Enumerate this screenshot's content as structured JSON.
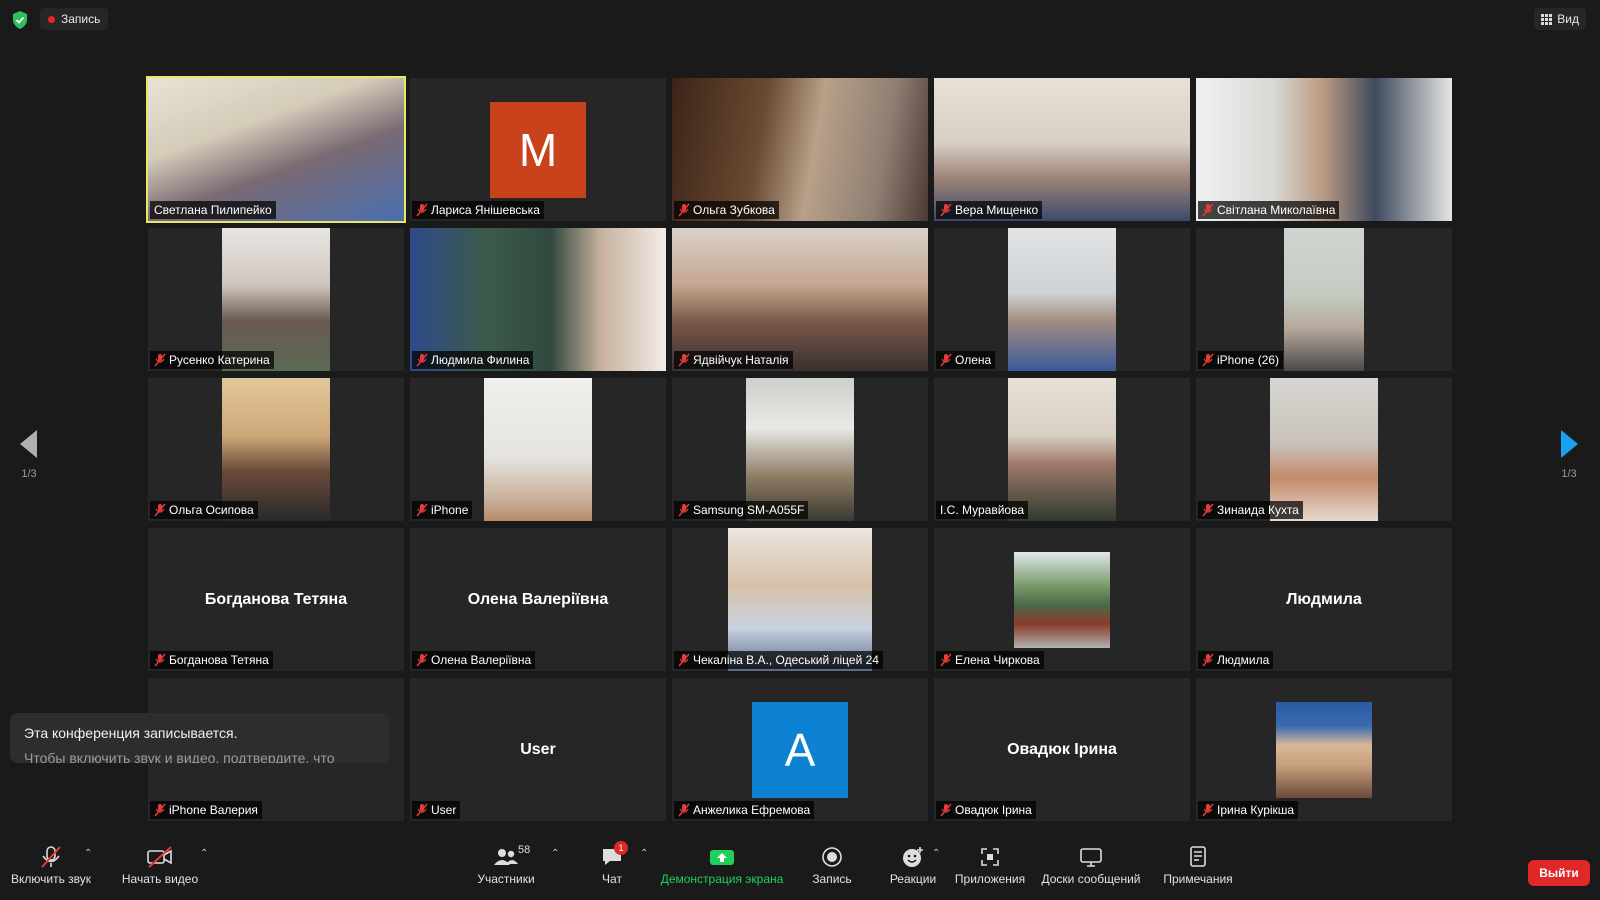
{
  "top": {
    "recording_label": "Запись",
    "view_label": "Вид"
  },
  "pager": {
    "left": "1/3",
    "right": "1/3"
  },
  "tiles": [
    {
      "name": "Светлана Пилипейко"
    },
    {
      "name": "Лариса Янішевська",
      "avatar": "M"
    },
    {
      "name": "Ольга Зубкова"
    },
    {
      "name": "Вера Мищенко"
    },
    {
      "name": "Світлана Миколаївна"
    },
    {
      "name": "Русенко Катерина"
    },
    {
      "name": "Людмила Филина"
    },
    {
      "name": "Ядвійчук Наталія"
    },
    {
      "name": "Олена"
    },
    {
      "name": "iPhone (26)"
    },
    {
      "name": "Ольга Осипова"
    },
    {
      "name": "iPhone"
    },
    {
      "name": "Samsung SM-A055F"
    },
    {
      "name": "І.С. Муравйова"
    },
    {
      "name": "Зинаида Кухта"
    },
    {
      "name": "Богданова Тетяна",
      "display": "Богданова Тетяна"
    },
    {
      "name": "Олена Валеріївна",
      "display": "Олена Валеріївна"
    },
    {
      "name": "Чекаліна В.А., Одеський ліцей 24"
    },
    {
      "name": "Елена Чиркова"
    },
    {
      "name": "Людмила",
      "display": "Людмила"
    },
    {
      "name": "iPhone Валерия"
    },
    {
      "name": "User",
      "display": "User"
    },
    {
      "name": "Анжелика Ефремова",
      "avatar": "A"
    },
    {
      "name": "Овадюк Ірина",
      "display": "Овадюк Ірина"
    },
    {
      "name": "Ірина Курікша"
    }
  ],
  "toast": {
    "line1": "Эта конференция записывается.",
    "line2": "Чтобы включить звук и видео, подтвердите, что"
  },
  "toolbar": {
    "mute": "Включить звук",
    "video": "Начать видео",
    "participants": "Участники",
    "participants_count": "58",
    "chat": "Чат",
    "chat_badge": "1",
    "share": "Демонстрация экрана",
    "record": "Запись",
    "reactions": "Реакции",
    "apps": "Приложения",
    "whiteboards": "Доски сообщений",
    "notes": "Примечания",
    "leave": "Выйти"
  },
  "colors": {
    "active_speaker": "#e8e66a",
    "share_green": "#1fd05a",
    "leave_red": "#e02828",
    "avatar_m": "#c9421b",
    "avatar_a": "#0e82d2",
    "arrow_blue": "#1aa0f0"
  }
}
